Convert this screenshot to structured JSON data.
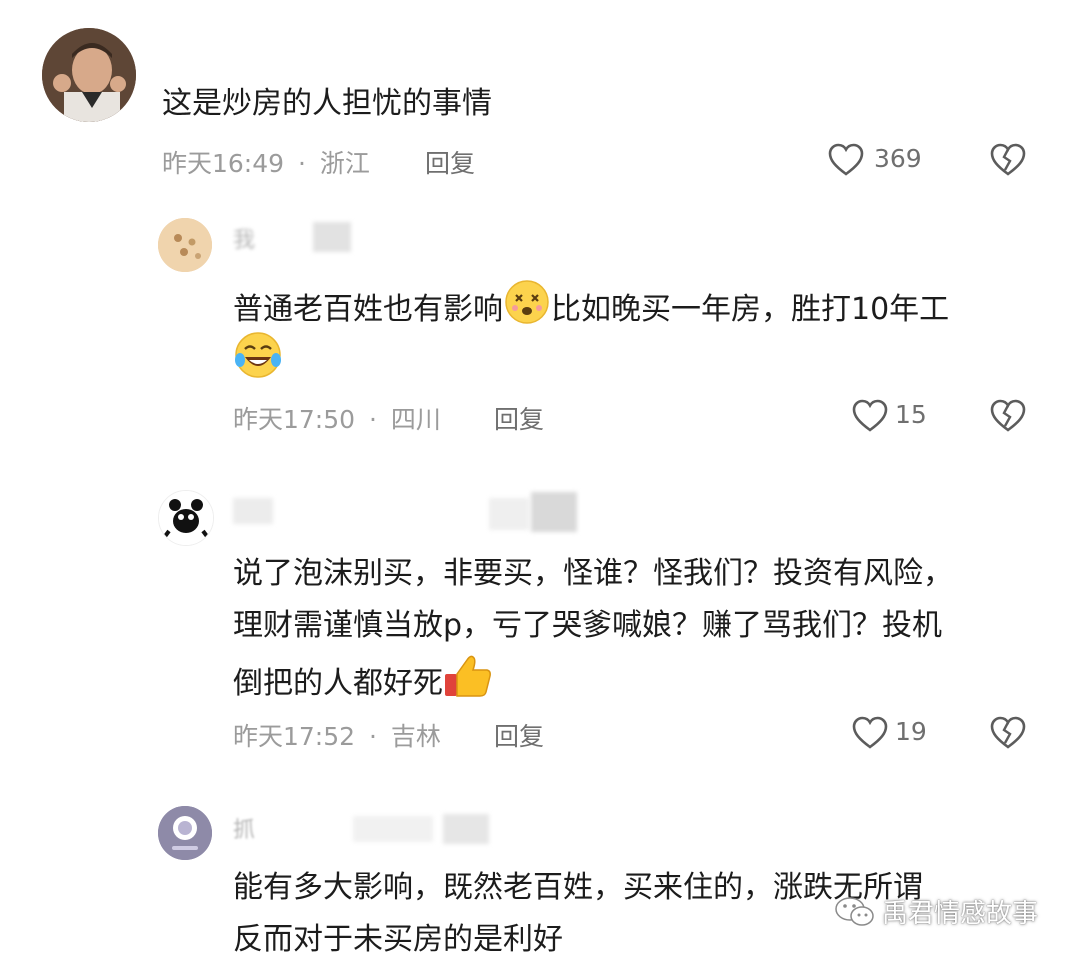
{
  "comments": [
    {
      "text": "这是炒房的人担忧的事情",
      "time": "昨天16:49",
      "location": "浙江",
      "reply": "回复",
      "likes": "369"
    },
    {
      "name_partial": "我",
      "text": "普通老百姓也有影响",
      "text_after_emoji": "比如晚买一年房，胜打10年工",
      "time": "昨天17:50",
      "location": "四川",
      "reply": "回复",
      "likes": "15"
    },
    {
      "line1": "说了泡沫别买，非要买，怪谁？怪我们？投资有风险，",
      "line2": "理财需谨慎当放p，亏了哭爹喊娘？赚了骂我们？投机",
      "line3": "倒把的人都好死",
      "time": "昨天17:52",
      "location": "吉林",
      "reply": "回复",
      "likes": "19"
    },
    {
      "name_partial": "抓",
      "line1": "能有多大影响，既然老百姓，买来住的，涨跌无所谓",
      "line2": "反而对于未买房的是利好"
    }
  ],
  "separator": "·",
  "watermark": "禹君情感故事",
  "icons": {
    "like": "heart-outline-icon",
    "dislike": "broken-heart-icon",
    "wechat": "wechat-logo-icon"
  }
}
